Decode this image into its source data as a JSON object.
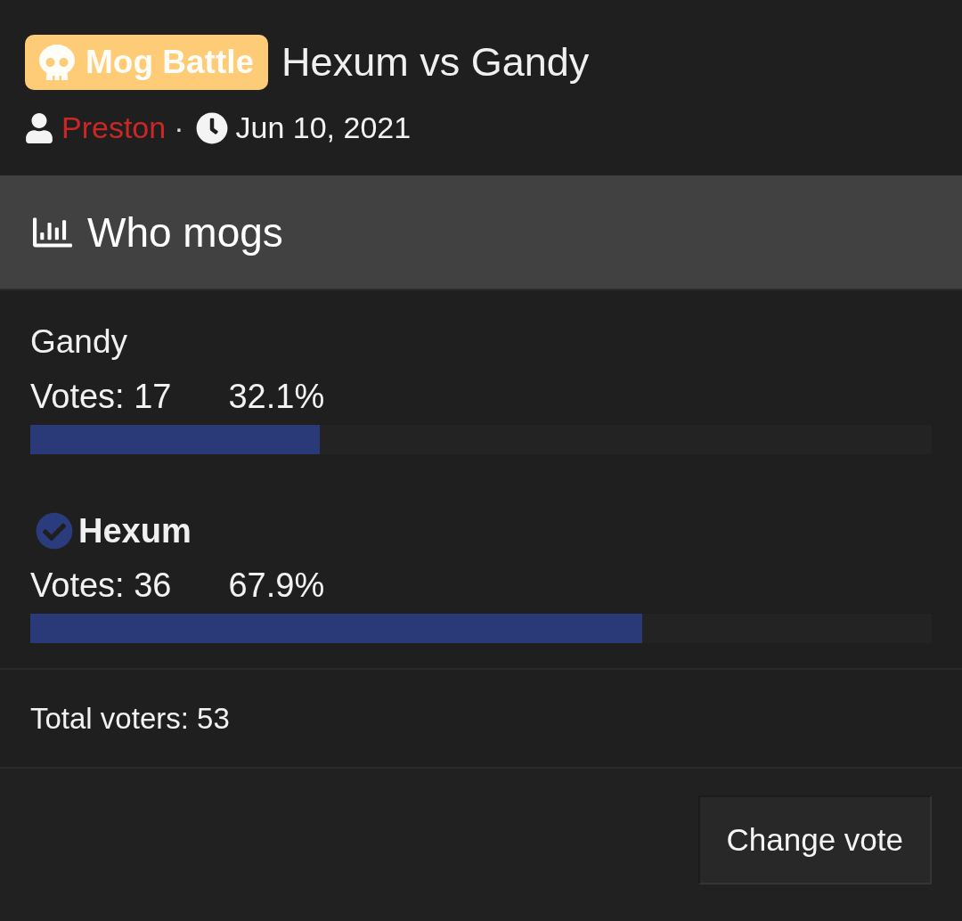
{
  "thread": {
    "prefix": {
      "label": "Mog Battle"
    },
    "title": "Hexum vs Gandy",
    "author": "Preston",
    "separator": "·",
    "date": "Jun 10, 2021"
  },
  "poll": {
    "title": "Who mogs",
    "options": [
      {
        "label": "Gandy",
        "votes": "Votes: 17",
        "percent": "32.1%",
        "level": 0.321,
        "selected": false
      },
      {
        "label": "Hexum",
        "votes": "Votes: 36",
        "percent": "67.9%",
        "level": 0.679,
        "selected": true
      }
    ],
    "total": "Total voters: 53",
    "buttons": [
      {
        "label": "Change vote"
      }
    ]
  }
}
